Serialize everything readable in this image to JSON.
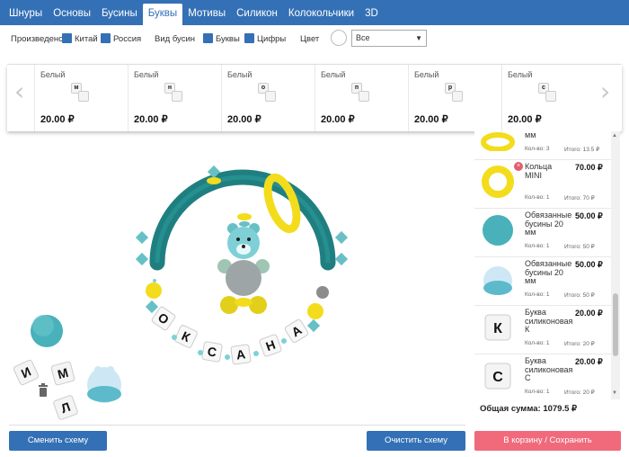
{
  "nav": {
    "tabs": [
      "Шнуры",
      "Основы",
      "Бусины",
      "Буквы",
      "Мотивы",
      "Силикон",
      "Колокольчики",
      "3D"
    ],
    "active_tab": "Буквы"
  },
  "filters": {
    "made_in_label": "Произведено",
    "china": "Китай",
    "russia": "Россия",
    "bead_type_label": "Вид бусин",
    "letters": "Буквы",
    "digits": "Цифры",
    "color_label": "Цвет",
    "color_value": "Все"
  },
  "carousel": {
    "items": [
      {
        "color": "Белый",
        "letter": "м",
        "price": "20.00 ₽"
      },
      {
        "color": "Белый",
        "letter": "н",
        "price": "20.00 ₽"
      },
      {
        "color": "Белый",
        "letter": "о",
        "price": "20.00 ₽"
      },
      {
        "color": "Белый",
        "letter": "п",
        "price": "20.00 ₽"
      },
      {
        "color": "Белый",
        "letter": "р",
        "price": "20.00 ₽"
      },
      {
        "color": "Белый",
        "letter": "с",
        "price": "20.00 ₽"
      }
    ]
  },
  "design": {
    "name_letters": [
      "О",
      "К",
      "С",
      "А",
      "Н",
      "А"
    ],
    "loose_letters": [
      "И",
      "М",
      "Л"
    ]
  },
  "cart": {
    "items": [
      {
        "name": "мм",
        "price": "",
        "qty": "Кол-во: 3",
        "total": "Итого: 13.5 ₽"
      },
      {
        "name": "Кольца MINI",
        "price": "70.00 ₽",
        "qty": "Кол-во: 1",
        "total": "Итого: 70 ₽"
      },
      {
        "name": "Обвязанные бусины 20 мм",
        "price": "50.00 ₽",
        "qty": "Кол-во: 1",
        "total": "Итого: 50 ₽"
      },
      {
        "name": "Обвязанные бусины 20 мм",
        "price": "50.00 ₽",
        "qty": "Кол-во: 1",
        "total": "Итого: 50 ₽"
      },
      {
        "name": "Буква силиконовая К",
        "price": "20.00 ₽",
        "qty": "Кол-во: 1",
        "total": "Итого: 20 ₽",
        "letter": "К"
      },
      {
        "name": "Буква силиконовая С",
        "price": "20.00 ₽",
        "qty": "Кол-во: 1",
        "total": "Итого: 20 ₽",
        "letter": "С"
      }
    ],
    "delete_symbol": "×",
    "total_label": "Общая сумма: 1079.5 ₽"
  },
  "buttons": {
    "change_scheme": "Сменить схему",
    "clear_scheme": "Очистить схему",
    "to_cart": "В корзину / Сохранить"
  },
  "colors": {
    "brand_blue": "#3470b5",
    "pink": "#f06a7c",
    "teal": "#1f7f80",
    "yellow": "#f3dc1c"
  }
}
